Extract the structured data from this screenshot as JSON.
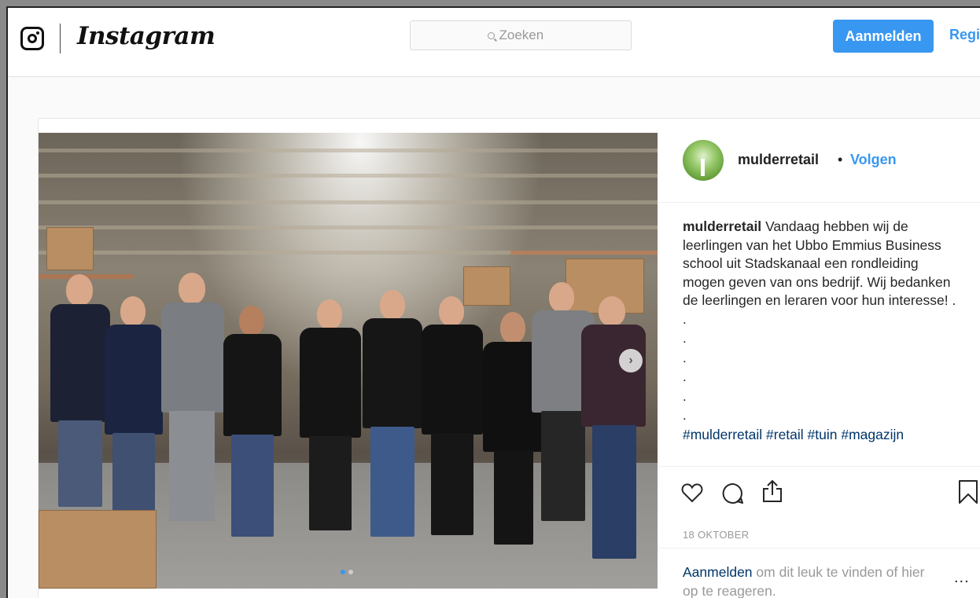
{
  "header": {
    "wordmark": "Instagram",
    "search_placeholder": "Zoeken",
    "login_button": "Aanmelden",
    "register_link": "Regis"
  },
  "post": {
    "photo_carousel": {
      "current_index": 1,
      "total": 2
    },
    "author": {
      "handle": "mulderretail",
      "separator": "•",
      "follow_label": "Volgen"
    },
    "caption": {
      "handle": "mulderretail",
      "text": "Vandaag hebben wij de leerlingen van het Ubbo Emmius Business school uit Stadskanaal een rondleiding mogen geven van ons bedrijf. Wij bedanken de leerlingen en leraren voor hun interesse! .",
      "dots": [
        ".",
        ".",
        ".",
        ".",
        ".",
        "."
      ],
      "hashtags": "#mulderretail #retail #tuin #magazijn"
    },
    "date": "18 OKTOBER",
    "footer": {
      "login_link": "Aanmelden",
      "rest": " om dit leuk te vinden of hier op te reageren.",
      "more": "..."
    }
  },
  "colors": {
    "accent": "#3897f0",
    "link_dark": "#003569",
    "muted": "#999999"
  }
}
